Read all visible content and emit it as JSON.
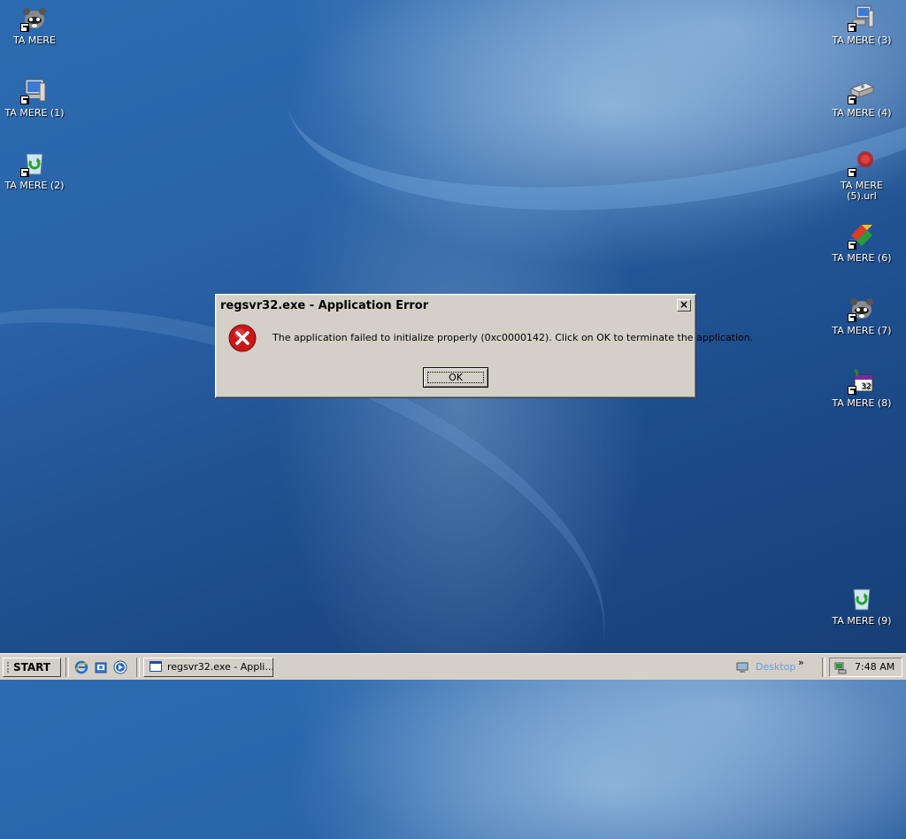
{
  "desktop": {
    "icons_left": [
      {
        "label": "TA MERE",
        "icon": "raccoon-icon"
      },
      {
        "label": "TA MERE (1)",
        "icon": "my-computer-icon"
      },
      {
        "label": "TA MERE (2)",
        "icon": "recycle-bin-icon"
      }
    ],
    "icons_right": [
      {
        "label": "TA MERE (3)",
        "icon": "network-computers-icon"
      },
      {
        "label": "TA MERE (4)",
        "icon": "drive-icon"
      },
      {
        "label": "TA MERE (5).url",
        "icon": "url-shortcut-icon"
      },
      {
        "label": "TA MERE (6)",
        "icon": "paint-tools-icon"
      },
      {
        "label": "TA MERE (7)",
        "icon": "raccoon-icon"
      },
      {
        "label": "TA MERE (8)",
        "icon": "calendar-app-icon"
      },
      {
        "label": "TA MERE (9)",
        "icon": "recycle-bin-icon"
      }
    ]
  },
  "dialog": {
    "title": "regsvr32.exe - Application Error",
    "close_label": "×",
    "message": "The application failed to initialize properly (0xc0000142). Click on OK to terminate the application.",
    "ok_label": "OK",
    "icon": "error-icon"
  },
  "taskbar": {
    "start_label": "START",
    "quick_launch": [
      "internet-explorer-icon",
      "outlook-express-icon",
      "media-player-icon"
    ],
    "task_label": "regsvr32.exe - Appli...",
    "desktop_toolbar_label": "Desktop",
    "chevron": "»",
    "clock": "7:48 AM"
  }
}
